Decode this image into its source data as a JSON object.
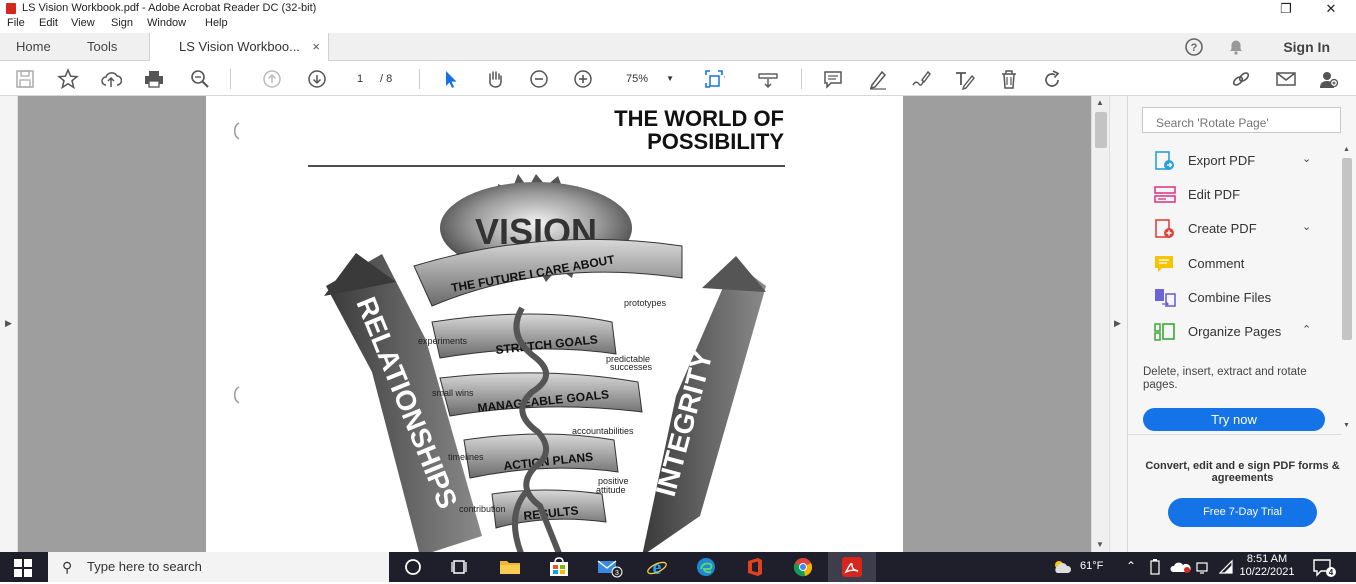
{
  "window": {
    "title": "LS Vision Workbook.pdf - Adobe Acrobat Reader DC (32-bit)",
    "restore_glyph": "❐",
    "close_glyph": "✕"
  },
  "menu": [
    "File",
    "Edit",
    "View",
    "Sign",
    "Window",
    "Help"
  ],
  "tabs": {
    "home": "Home",
    "tools": "Tools",
    "doc": "LS Vision Workboo...",
    "close": "×"
  },
  "header": {
    "sign_in": "Sign In"
  },
  "toolbar": {
    "page_current": "1",
    "page_total": "/ 8",
    "zoom": "75%"
  },
  "document": {
    "heading_line1": "THE WORLD OF",
    "heading_line2": "POSSIBILITY",
    "vision": "VISION",
    "band1": "THE FUTURE I CARE ABOUT",
    "band2": "STRETCH GOALS",
    "band3": "MANAGEABLE GOALS",
    "band4": "ACTION PLANS",
    "band5": "RESULTS",
    "left_arrow": "RELATIONSHIPS",
    "right_arrow": "INTEGRITY",
    "labels": [
      "prototypes",
      "experiments",
      "predictable",
      "successes",
      "small wins",
      "accountabilities",
      "timelines",
      "positive",
      "attitude",
      "contribution"
    ]
  },
  "right_panel": {
    "search_placeholder": "Search 'Rotate Page'",
    "tools": [
      {
        "label": "Export PDF",
        "has_chevron": true,
        "chevron": "⌄",
        "color": "#2aa0d8"
      },
      {
        "label": "Edit PDF",
        "has_chevron": false,
        "chevron": "",
        "color": "#e03c8a"
      },
      {
        "label": "Create PDF",
        "has_chevron": true,
        "chevron": "⌄",
        "color": "#e0443e"
      },
      {
        "label": "Comment",
        "has_chevron": false,
        "chevron": "",
        "color": "#f6c400"
      },
      {
        "label": "Combine Files",
        "has_chevron": false,
        "chevron": "",
        "color": "#6c63d8"
      },
      {
        "label": "Organize Pages",
        "has_chevron": true,
        "chevron": "⌃",
        "color": "#39a935"
      }
    ],
    "tool_description": "Delete, insert, extract and rotate pages.",
    "try_now": "Try now",
    "promo": "Convert, edit and e sign PDF forms & agreements",
    "trial_button": "Free 7-Day Trial"
  },
  "taskbar": {
    "search_placeholder": "Type here to search",
    "weather": "61°F",
    "time": "8:51 AM",
    "date": "10/22/2021",
    "mail_badge": "3",
    "notification_badge": "4"
  },
  "colors": {
    "accent": "#1473e6",
    "taskbar": "#1f1f2b",
    "viewer_bg": "#9e9e9e"
  }
}
